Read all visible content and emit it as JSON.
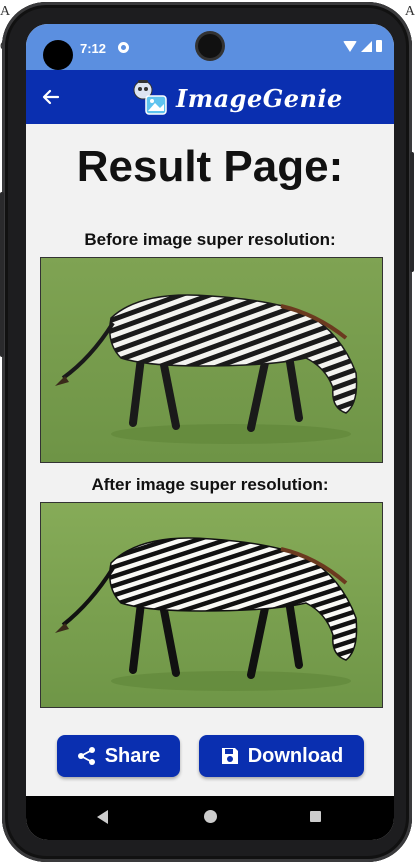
{
  "background": {
    "left_letter": "A",
    "right_letter": "A",
    "left_letter2": "C"
  },
  "status_bar": {
    "time": "7:12"
  },
  "app_bar": {
    "title": "ImageGenie",
    "back_icon": "arrow-left-icon",
    "logo_icon": "robot-image-icon"
  },
  "content": {
    "page_title": "Result Page:",
    "before_caption": "Before image super resolution:",
    "after_caption": "After image super resolution:"
  },
  "buttons": {
    "share_label": "Share",
    "share_icon": "share-icon",
    "download_label": "Download",
    "download_icon": "save-icon"
  },
  "colors": {
    "status_bar": "#5b8fe0",
    "app_bar": "#0a2fb0",
    "button": "#0a2fb0",
    "screen_bg": "#f2f2f2"
  }
}
